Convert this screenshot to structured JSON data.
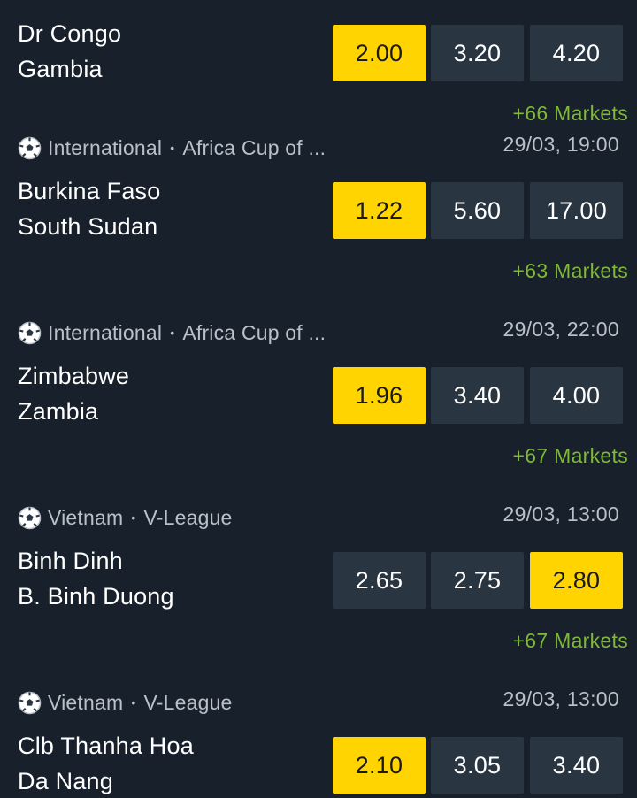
{
  "matches": [
    {
      "country": "",
      "competition": "",
      "datetime": "",
      "home": "Dr Congo",
      "away": "Gambia",
      "odds": [
        "2.00",
        "3.20",
        "4.20"
      ],
      "selected": 0,
      "markets": "+66 Markets"
    },
    {
      "country": "International",
      "competition": "Africa Cup of ...",
      "datetime": "29/03, 19:00",
      "home": "Burkina Faso",
      "away": "South Sudan",
      "odds": [
        "1.22",
        "5.60",
        "17.00"
      ],
      "selected": 0,
      "markets": "+63 Markets"
    },
    {
      "country": "International",
      "competition": "Africa Cup of ...",
      "datetime": "29/03, 22:00",
      "home": "Zimbabwe",
      "away": "Zambia",
      "odds": [
        "1.96",
        "3.40",
        "4.00"
      ],
      "selected": 0,
      "markets": "+67 Markets"
    },
    {
      "country": "Vietnam",
      "competition": "V-League",
      "datetime": "29/03, 13:00",
      "home": "Binh Dinh",
      "away": "B. Binh Duong",
      "odds": [
        "2.65",
        "2.75",
        "2.80"
      ],
      "selected": 2,
      "markets": "+67 Markets"
    },
    {
      "country": "Vietnam",
      "competition": "V-League",
      "datetime": "29/03, 13:00",
      "home": "Clb Thanha Hoa",
      "away": "Da Nang",
      "odds": [
        "2.10",
        "3.05",
        "3.40"
      ],
      "selected": 0,
      "markets": ""
    }
  ],
  "icons": {
    "sport": "soccer-ball-icon"
  },
  "colors": {
    "background": "#18202b",
    "odd_button": "#2a3542",
    "odd_selected": "#ffd400",
    "markets_link": "#7fb83a",
    "meta_text": "#b9c0c8"
  }
}
